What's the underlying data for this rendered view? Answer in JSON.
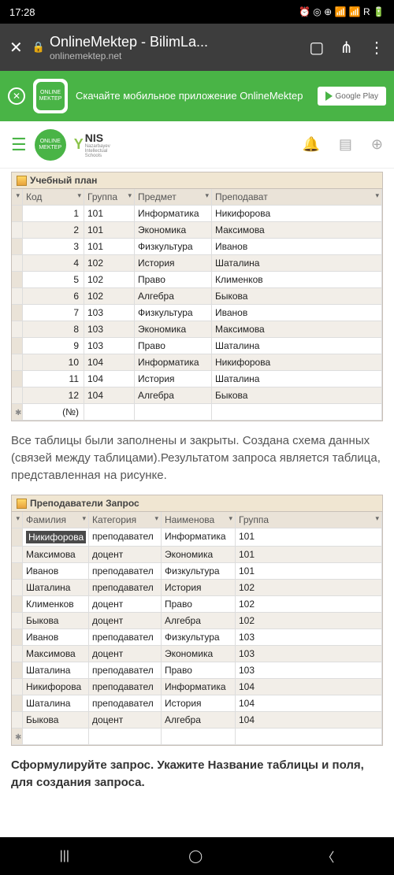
{
  "status": {
    "time": "17:28",
    "icons": "⏰ ◎ ⊕ 📶 📶 R 🔋"
  },
  "browser": {
    "title": "OnlineMektep - BilimLa...",
    "url": "onlinemektep.net"
  },
  "promo": {
    "text": "Скачайте мобильное приложение OnlineMektep",
    "button": "Google Play",
    "logo1": "ONLINE",
    "logo2": "MEKTEP"
  },
  "header": {
    "logo1": "ONLINE",
    "logo2": "MEKTEP",
    "nis": "NIS",
    "nis_sub1": "Nazarbayev",
    "nis_sub2": "Intellectual",
    "nis_sub3": "Schools"
  },
  "table1": {
    "title": "Учебный план",
    "cols": [
      "Код",
      "Группа",
      "Предмет",
      "Преподават"
    ],
    "rows": [
      [
        "1",
        "101",
        "Информатика",
        "Никифорова"
      ],
      [
        "2",
        "101",
        "Экономика",
        "Максимова"
      ],
      [
        "3",
        "101",
        "Физкультура",
        "Иванов"
      ],
      [
        "4",
        "102",
        "История",
        "Шаталина"
      ],
      [
        "5",
        "102",
        "Право",
        "Клименков"
      ],
      [
        "6",
        "102",
        "Алгебра",
        "Быкова"
      ],
      [
        "7",
        "103",
        "Физкультура",
        "Иванов"
      ],
      [
        "8",
        "103",
        "Экономика",
        "Максимова"
      ],
      [
        "9",
        "103",
        "Право",
        "Шаталина"
      ],
      [
        "10",
        "104",
        "Информатика",
        "Никифорова"
      ],
      [
        "11",
        "104",
        "История",
        "Шаталина"
      ],
      [
        "12",
        "104",
        "Алгебра",
        "Быкова"
      ]
    ],
    "footer": "(№)"
  },
  "para1": "Все таблицы были заполнены и закрыты. Создана схема данных (связей между таблицами).Результатом запроса является таблица, представленная на рисунке.",
  "table2": {
    "title": "Преподаватели Запрос",
    "cols": [
      "Фамилия",
      "Категория",
      "Наименова",
      "Группа"
    ],
    "rows": [
      [
        "Никифорова",
        "преподавател",
        "Информатика",
        "101"
      ],
      [
        "Максимова",
        "доцент",
        "Экономика",
        "101"
      ],
      [
        "Иванов",
        "преподавател",
        "Физкультура",
        "101"
      ],
      [
        "Шаталина",
        "преподавател",
        "История",
        "102"
      ],
      [
        "Клименков",
        "доцент",
        "Право",
        "102"
      ],
      [
        "Быкова",
        "доцент",
        "Алгебра",
        "102"
      ],
      [
        "Иванов",
        "преподавател",
        "Физкультура",
        "103"
      ],
      [
        "Максимова",
        "доцент",
        "Экономика",
        "103"
      ],
      [
        "Шаталина",
        "преподавател",
        "Право",
        "103"
      ],
      [
        "Никифорова",
        "преподавател",
        "Информатика",
        "104"
      ],
      [
        "Шаталина",
        "преподавател",
        "История",
        "104"
      ],
      [
        "Быкова",
        "доцент",
        "Алгебра",
        "104"
      ]
    ]
  },
  "para2": "Сформулируйте запрос. Укажите Название таблицы и поля, для создания запроса."
}
